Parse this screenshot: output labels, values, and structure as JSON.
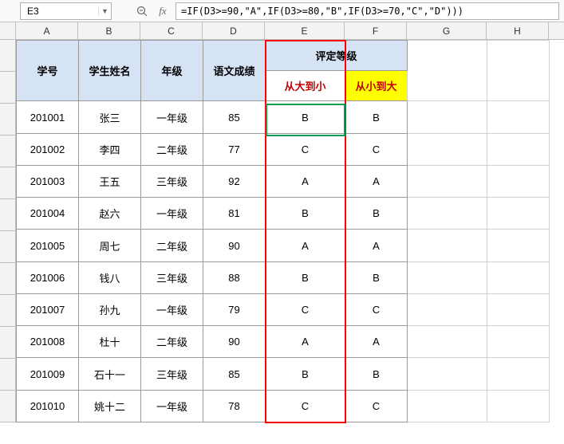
{
  "name_box": "E3",
  "formula": "=IF(D3>=90,\"A\",IF(D3>=80,\"B\",IF(D3>=70,\"C\",\"D\")))",
  "col_headers": [
    "A",
    "B",
    "C",
    "D",
    "E",
    "F",
    "G",
    "H"
  ],
  "merged_header": "评定等级",
  "headers": {
    "id": "学号",
    "name": "学生姓名",
    "grade": "年级",
    "score": "语文成绩",
    "desc": "从大到小",
    "asc": "从小到大"
  },
  "rows": [
    {
      "id": "201001",
      "name": "张三",
      "grade": "一年级",
      "score": "85",
      "e": "B",
      "f": "B"
    },
    {
      "id": "201002",
      "name": "李四",
      "grade": "二年级",
      "score": "77",
      "e": "C",
      "f": "C"
    },
    {
      "id": "201003",
      "name": "王五",
      "grade": "三年级",
      "score": "92",
      "e": "A",
      "f": "A"
    },
    {
      "id": "201004",
      "name": "赵六",
      "grade": "一年级",
      "score": "81",
      "e": "B",
      "f": "B"
    },
    {
      "id": "201005",
      "name": "周七",
      "grade": "二年级",
      "score": "90",
      "e": "A",
      "f": "A"
    },
    {
      "id": "201006",
      "name": "钱八",
      "grade": "三年级",
      "score": "88",
      "e": "B",
      "f": "B"
    },
    {
      "id": "201007",
      "name": "孙九",
      "grade": "一年级",
      "score": "79",
      "e": "C",
      "f": "C"
    },
    {
      "id": "201008",
      "name": "杜十",
      "grade": "二年级",
      "score": "90",
      "e": "A",
      "f": "A"
    },
    {
      "id": "201009",
      "name": "石十一",
      "grade": "三年级",
      "score": "85",
      "e": "B",
      "f": "B"
    },
    {
      "id": "201010",
      "name": "姚十二",
      "grade": "一年级",
      "score": "78",
      "e": "C",
      "f": "C"
    }
  ]
}
